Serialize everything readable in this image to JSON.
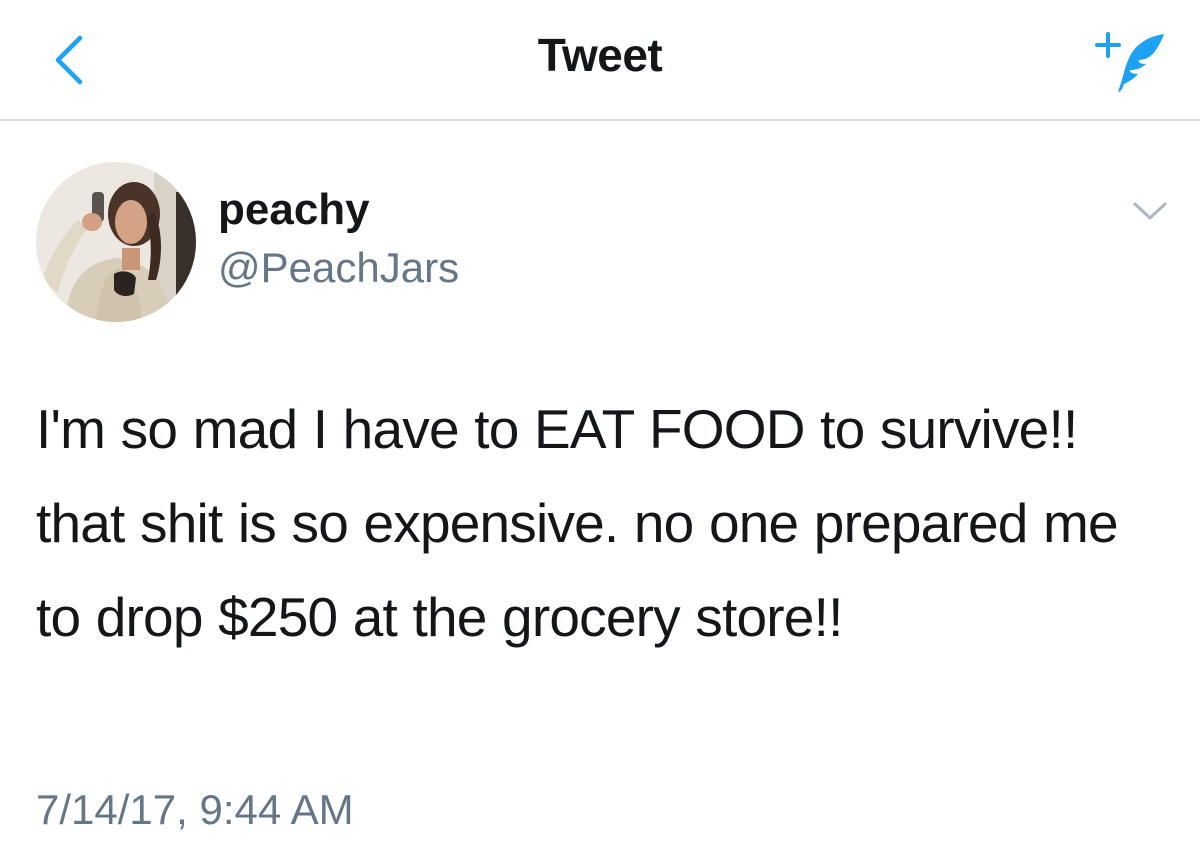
{
  "navbar": {
    "title": "Tweet",
    "back_icon": "chevron-left-icon",
    "compose_icon": "compose-tweet-icon",
    "accent_color": "#1da1f2"
  },
  "tweet": {
    "author": {
      "display_name": "peachy",
      "handle": "@PeachJars"
    },
    "text": "I'm so mad I have to EAT FOOD to survive!! that shit is so expensive. no one prepared me to drop $250 at the grocery store!!",
    "timestamp": "7/14/17, 9:44 AM",
    "menu_icon": "chevron-down-icon"
  },
  "colors": {
    "text": "#14171a",
    "secondary": "#657786",
    "divider": "#d8dde2",
    "accent": "#1da1f2"
  }
}
